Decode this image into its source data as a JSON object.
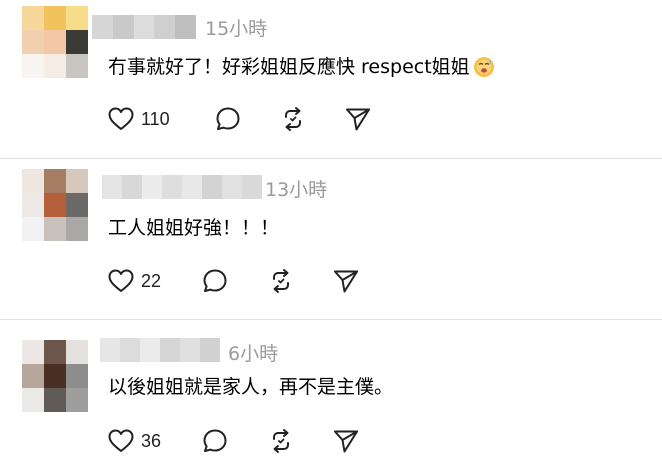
{
  "comments": [
    {
      "time": "15小時",
      "text": "冇事就好了！好彩姐姐反應快 respect姐姐",
      "emoji": "smiling-face-with-sweat-emoji",
      "likes": "110",
      "avatar_colors": [
        "#f7d79a",
        "#f2c35c",
        "#f7dd8a",
        "#f1d0b0",
        "#f3c8a6",
        "#3c3a37",
        "#f8f4ef",
        "#f4ede6",
        "#c9c6c2"
      ],
      "username_colors": [
        "#d6d6d6",
        "#c9c9c9",
        "#dcdcdc",
        "#cfcfcf",
        "#bfbfbf"
      ]
    },
    {
      "time": "13小時",
      "text": "工人姐姐好強！！！",
      "likes": "22",
      "avatar_colors": [
        "#ede6e1",
        "#a47d63",
        "#d7c8bd",
        "#ece8e5",
        "#b55f3a",
        "#6c6a69",
        "#f2f2f2",
        "#c8c2bd",
        "#a9a8a7"
      ],
      "username_colors": [
        "#e4e4e4",
        "#d8d8d8",
        "#ececec",
        "#dedede",
        "#e8e8e8",
        "#d3d3d3",
        "#e1e1e1",
        "#d9d9d9"
      ]
    },
    {
      "time": "6小時",
      "text": "以後姐姐就是家人，再不是主僕。",
      "likes": "36",
      "avatar_colors": [
        "#ece7e4",
        "#6d564b",
        "#e3e0de",
        "#b8a59b",
        "#4a2f25",
        "#8d8d8d",
        "#ebe9e8",
        "#5f5b59",
        "#9e9e9e"
      ],
      "username_colors": [
        "#e6e6e6",
        "#dcdcdc",
        "#ebebeb",
        "#d6d6d6",
        "#e0e0e0",
        "#d1d1d1"
      ]
    }
  ],
  "icons": {
    "like": "heart-icon",
    "reply": "comment-bubble-icon",
    "repost": "repost-icon",
    "share": "send-icon"
  },
  "colors": {
    "time": "#9a9a9a",
    "divider": "#e0e0e0",
    "text": "#000000"
  }
}
